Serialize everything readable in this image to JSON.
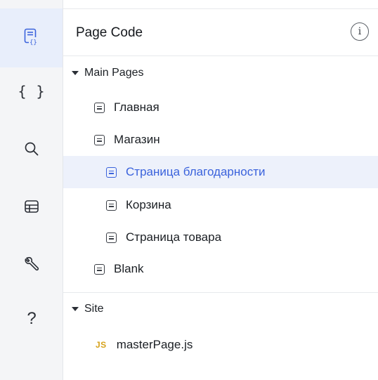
{
  "sidebar_rail": {
    "items": [
      {
        "name": "page-code",
        "icon": "page-code-icon",
        "active": true
      },
      {
        "name": "code-files",
        "icon": "curly-braces-icon",
        "glyph": "{ }"
      },
      {
        "name": "search",
        "icon": "search-icon"
      },
      {
        "name": "databases",
        "icon": "database-table-icon"
      },
      {
        "name": "developer-tools",
        "icon": "wrench-icon"
      },
      {
        "name": "help",
        "icon": "question-icon",
        "glyph": "?"
      }
    ]
  },
  "panel": {
    "title": "Page Code",
    "info_glyph": "i",
    "sections": [
      {
        "label": "Main Pages",
        "expanded": true,
        "pages": [
          {
            "label": "Главная",
            "level": 1,
            "selected": false
          },
          {
            "label": "Магазин",
            "level": 1,
            "selected": false
          },
          {
            "label": "Страница благодарности",
            "level": 2,
            "selected": true
          },
          {
            "label": "Корзина",
            "level": 2,
            "selected": false
          },
          {
            "label": "Страница товара",
            "level": 2,
            "selected": false
          },
          {
            "label": "Blank",
            "level": 1,
            "selected": false
          }
        ]
      },
      {
        "label": "Site",
        "expanded": true,
        "files": [
          {
            "badge": "JS",
            "label": "masterPage.js"
          }
        ]
      }
    ]
  },
  "colors": {
    "accent": "#3a62dc",
    "selected_bg": "#edf1fb",
    "rail_bg": "#f4f5f7",
    "js_badge": "#d6a21b"
  }
}
